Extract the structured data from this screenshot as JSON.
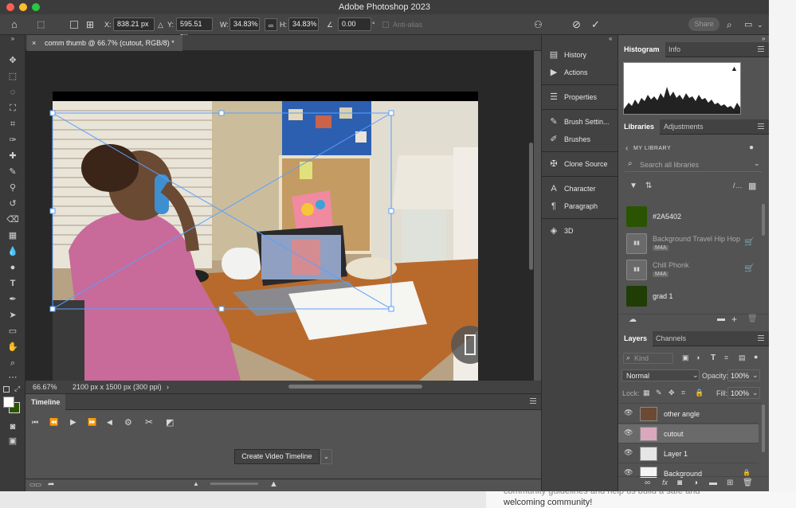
{
  "app": {
    "title": "Adobe Photoshop 2023"
  },
  "options_bar": {
    "x_label": "X:",
    "x_value": "838.21 px",
    "y_label": "Y:",
    "y_value": "595.51 px",
    "w_label": "W:",
    "w_value": "34.83%",
    "h_label": "H:",
    "h_value": "34.83%",
    "angle_value": "0.00",
    "degree": "°",
    "antialias_label": "Anti-alias",
    "share_label": "Share"
  },
  "document": {
    "tab_title": "comm thumb @ 66.7% (cutout, RGB/8) *",
    "zoom": "66.67%",
    "dimensions": "2100 px x 1500 px (300 ppi)"
  },
  "timeline": {
    "title": "Timeline",
    "create_button": "Create Video Timeline"
  },
  "collapsed_panels": [
    {
      "label": "History",
      "icon": "history-icon",
      "glyph": "▤"
    },
    {
      "label": "Actions",
      "icon": "actions-icon",
      "glyph": "▶"
    },
    {
      "label": "Properties",
      "icon": "properties-icon",
      "glyph": "☰"
    },
    {
      "label": "Brush Settin...",
      "icon": "brush-settings-icon",
      "glyph": "✎"
    },
    {
      "label": "Brushes",
      "icon": "brushes-icon",
      "glyph": "✐"
    },
    {
      "label": "Clone Source",
      "icon": "clone-source-icon",
      "glyph": "✠"
    },
    {
      "label": "Character",
      "icon": "character-icon",
      "glyph": "A"
    },
    {
      "label": "Paragraph",
      "icon": "paragraph-icon",
      "glyph": "¶"
    },
    {
      "label": "3D",
      "icon": "3d-icon",
      "glyph": "◈"
    }
  ],
  "histogram_panel": {
    "tabs": [
      "Histogram",
      "Info"
    ]
  },
  "libraries_panel": {
    "tabs": [
      "Libraries",
      "Adjustments"
    ],
    "library_name": "MY LIBRARY",
    "search_placeholder": "Search all libraries",
    "items": [
      {
        "name": "#2A5402",
        "type": "color",
        "color": "#2A5402"
      },
      {
        "name": "Background Travel Hip Hop",
        "badge": "M4A",
        "type": "audio"
      },
      {
        "name": "Chill Phonk",
        "badge": "M4A",
        "type": "audio"
      },
      {
        "name": "grad 1",
        "type": "gradient",
        "color": "#1f3d05"
      }
    ]
  },
  "layers_panel": {
    "tabs": [
      "Layers",
      "Channels"
    ],
    "kind_placeholder": "Kind",
    "blend_mode": "Normal",
    "opacity_label": "Opacity:",
    "opacity_value": "100%",
    "lock_label": "Lock:",
    "fill_label": "Fill:",
    "fill_value": "100%",
    "layers": [
      {
        "name": "other angle",
        "selected": false
      },
      {
        "name": "cutout",
        "selected": true
      },
      {
        "name": "Layer 1",
        "selected": false
      },
      {
        "name": "Background",
        "selected": false
      }
    ]
  },
  "background_page": {
    "line1": "community guidelines and help us build a safe and",
    "line2": "welcoming community!"
  },
  "colors": {
    "foreground": "#ffffff",
    "background_swatch": "#2A5402"
  }
}
